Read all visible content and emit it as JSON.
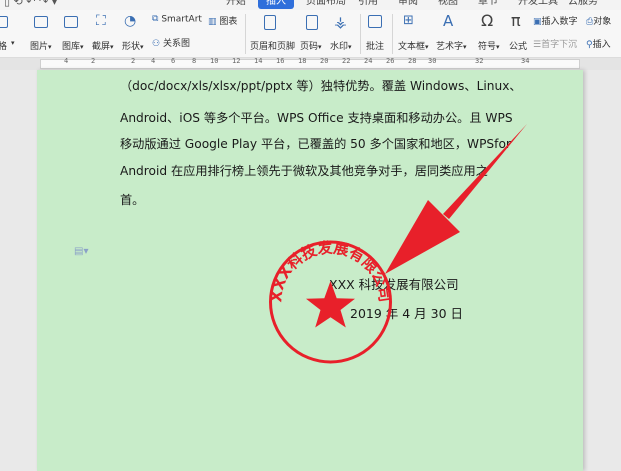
{
  "toolbar": {
    "tabs": [
      "开始",
      "插入",
      "页面布局",
      "引用",
      "审阅",
      "视图",
      "章节",
      "开发工具",
      "云服务"
    ],
    "active_tab": "插入",
    "buttons": {
      "picture": "图片",
      "gallery": "图库",
      "screenshot": "截屏",
      "shape": "形状",
      "smartart": "SmartArt",
      "chart": "图表",
      "relation": "关系图",
      "header_footer": "页眉和页脚",
      "page_number": "页码",
      "watermark": "水印",
      "comment": "批注",
      "textbox": "文本框",
      "wordart": "艺术字",
      "symbol": "符号",
      "formula": "公式",
      "insert_number": "插入数字",
      "object": "对象",
      "first_drop": "首字下沉",
      "insert": "插入",
      "left_cut": "格"
    }
  },
  "ruler": {
    "labels": [
      "4",
      "2",
      "2",
      "4",
      "6",
      "8",
      "10",
      "12",
      "14",
      "16",
      "18",
      "20",
      "22",
      "24",
      "26",
      "28",
      "30",
      "32",
      "34"
    ]
  },
  "document": {
    "lines": [
      "（doc/docx/xls/xlsx/ppt/pptx 等）独特优势。覆盖 Windows、Linux、",
      "Android、iOS 等多个平台。WPS Office 支持桌面和移动办公。且 WPS",
      "移动版通过 Google Play 平台，已覆盖的 50 多个国家和地区，WPSfor",
      "Android 在应用排行榜上领先于微软及其他竞争对手，居同类应用之",
      "首。"
    ],
    "company": "XXX 科技发展有限公司",
    "date": "2019 年 4 月 30 日",
    "seal_text": "XXX科技发展有限公司"
  },
  "colors": {
    "page_bg": "#c8ecc9",
    "seal_red": "#e8202a",
    "active_tab": "#2f6fdb"
  }
}
